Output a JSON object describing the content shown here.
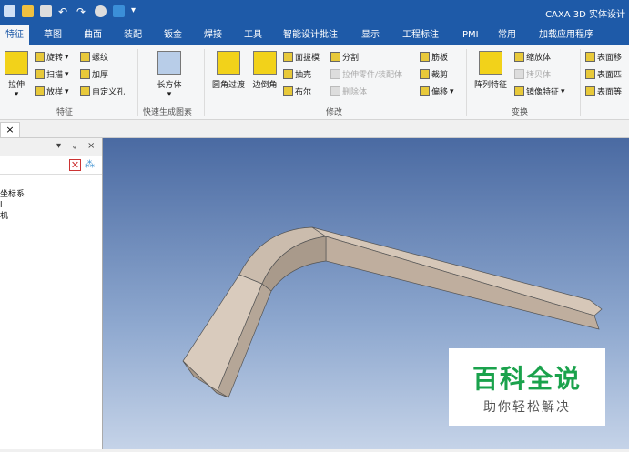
{
  "app_title": "CAXA 3D 实体设计",
  "tabs": [
    "特征",
    "草图",
    "曲面",
    "装配",
    "钣金",
    "焊接",
    "工具",
    "智能设计批注",
    "显示",
    "工程标注",
    "PMI",
    "常用",
    "加载应用程序"
  ],
  "ribbon": {
    "feature": {
      "extrude": "拉伸",
      "revolve": "旋转",
      "sweep": "扫描",
      "loft": "放样",
      "thread": "螺纹",
      "thicken": "加厚",
      "custom_hole": "自定义孔",
      "group": "特征"
    },
    "quick": {
      "box": "长方体",
      "group": "快速生成图素"
    },
    "modify": {
      "fillet": "圆角过渡",
      "chamfer": "边倒角",
      "draft": "面拔模",
      "shell": "抽壳",
      "boolean": "布尔",
      "split": "分割",
      "extrude_part": "拉伸零件/装配体",
      "delete_body": "删除体",
      "rib": "筋板",
      "trim": "裁剪",
      "offset": "偏移",
      "group": "修改"
    },
    "transform": {
      "pattern": "阵列特征",
      "scale": "缩放体",
      "copy": "拷贝体",
      "mirror": "镜像特征",
      "group": "变换"
    },
    "surface": {
      "move": "表面移",
      "match": "表面匹",
      "equal": "表面等"
    }
  },
  "doc_tab_close": "×",
  "panel": {
    "tree": [
      "坐标系",
      "l",
      "机"
    ]
  },
  "watermark": {
    "title": "百科全说",
    "subtitle": "助你轻松解决"
  }
}
